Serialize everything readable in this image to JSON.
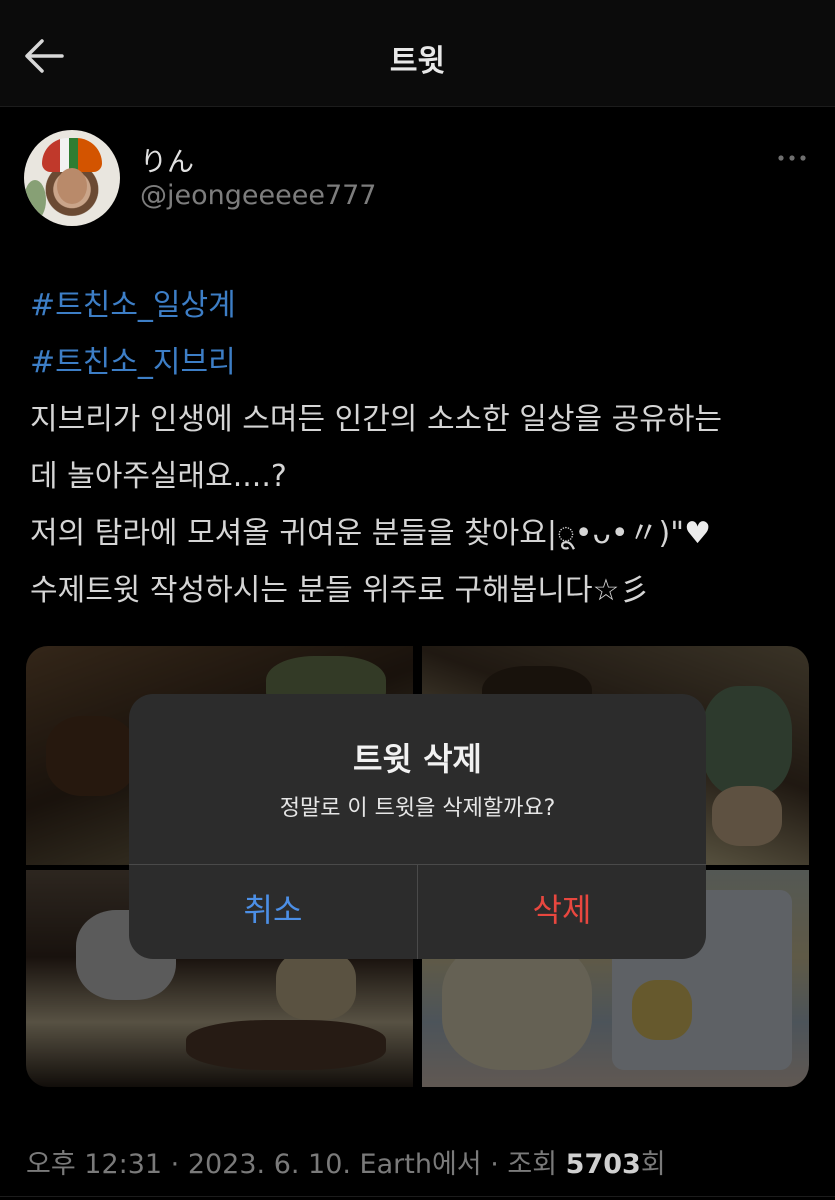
{
  "header": {
    "title": "트윗"
  },
  "author": {
    "display_name": "りん",
    "handle": "@jeongeeeee777"
  },
  "tweet": {
    "hashtag1": "#트친소_일상계",
    "hashtag2": "#트친소_지브리",
    "line1": "지브리가 인생에 스며든 인간의 소소한 일상을 공유하는",
    "line2": "데 놀아주실래요....?",
    "line3": "저의 탐라에 모셔올 귀여운 분들을 찾아요|ू•ᴗ•〃)\"",
    "line3_heart": "♥",
    "line4": "수제트윗 작성하시는 분들 위주로 구해봅니다☆彡"
  },
  "dialog": {
    "title": "트윗 삭제",
    "message": "정말로 이 트윗을 삭제할까요?",
    "cancel_label": "취소",
    "delete_label": "삭제"
  },
  "meta": {
    "time_date_source": "오후 12:31 · 2023. 6. 10. Earth에서 · 조회 ",
    "views": "5703",
    "views_suffix": "회"
  },
  "colors": {
    "hashtag": "#3d7ec6",
    "cancel": "#4c8fe6",
    "delete": "#e8473f"
  },
  "icons": {
    "back": "arrow-left-icon",
    "more": "more-horizontal-icon"
  }
}
